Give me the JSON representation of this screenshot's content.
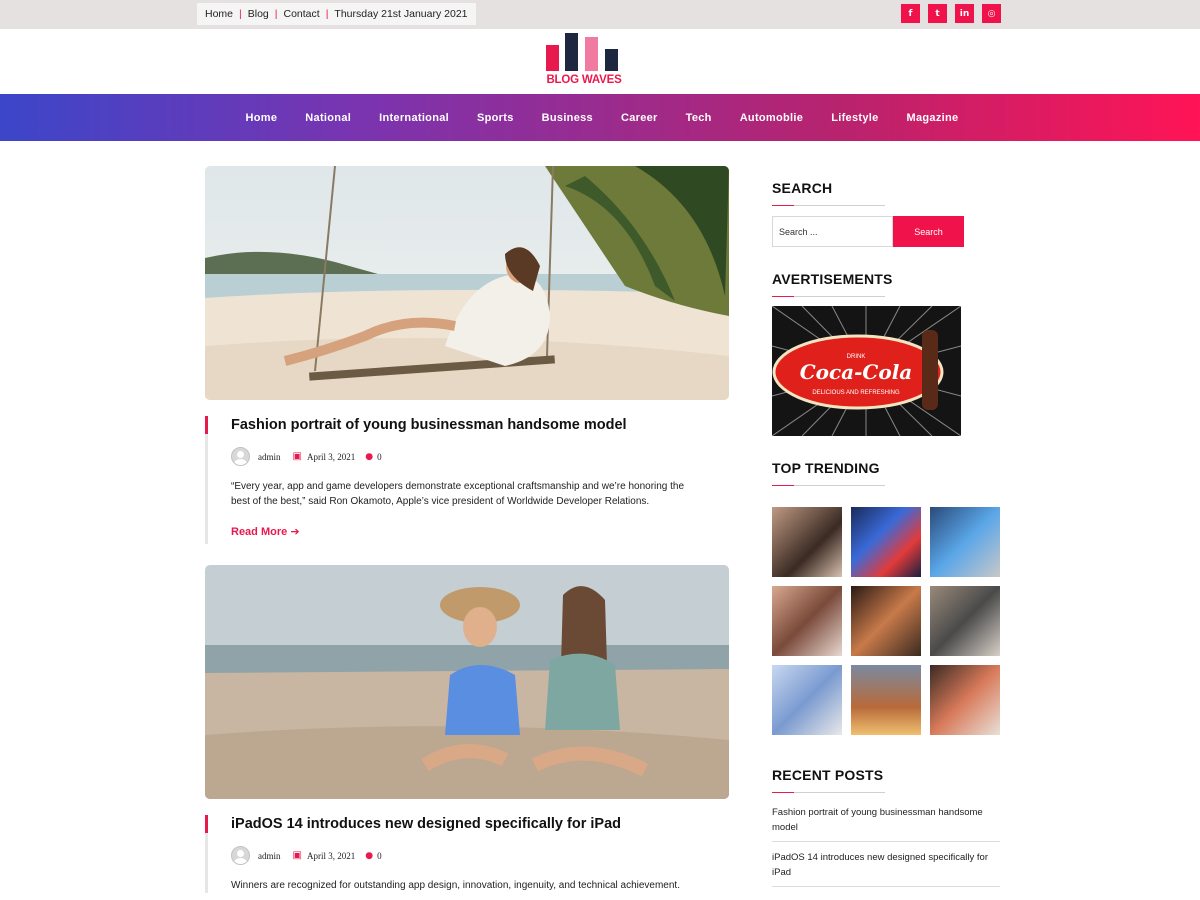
{
  "topbar": {
    "links": [
      "Home",
      "Blog",
      "Contact"
    ],
    "date": "Thursday 21st January 2021",
    "social": [
      {
        "icon": "facebook-icon",
        "glyph": "f"
      },
      {
        "icon": "twitter-icon",
        "glyph": "t"
      },
      {
        "icon": "linkedin-icon",
        "glyph": "in"
      },
      {
        "icon": "instagram-icon",
        "glyph": "◎"
      }
    ]
  },
  "logo": {
    "text": "BLOG WAVES"
  },
  "nav": {
    "items": [
      "Home",
      "National",
      "International",
      "Sports",
      "Business",
      "Career",
      "Tech",
      "Automoblie",
      "Lifestyle",
      "Magazine"
    ]
  },
  "posts": [
    {
      "title": "Fashion portrait of young businessman handsome model",
      "author": "admin",
      "date": "April 3, 2021",
      "comments": "0",
      "excerpt": "“Every year, app and game developers demonstrate exceptional craftsmanship and we’re honoring the best of the best,” said Ron Okamoto, Apple’s vice president of Worldwide Developer Relations.",
      "read_more": "Read More"
    },
    {
      "title": "iPadOS 14 introduces new designed specifically for iPad",
      "author": "admin",
      "date": "April 3, 2021",
      "comments": "0",
      "excerpt": "Winners are recognized for outstanding app design, innovation, ingenuity, and technical achievement."
    }
  ],
  "sidebar": {
    "search": {
      "title": "SEARCH",
      "placeholder": "Search ...",
      "button": "Search"
    },
    "ads": {
      "title": "AVERTISEMENTS",
      "ad_text": "Coca-Cola",
      "ad_sub": "DELICIOUS AND REFRESHING",
      "ad_drink": "DRINK"
    },
    "trending": {
      "title": "TOP TRENDING"
    },
    "recent": {
      "title": "RECENT POSTS",
      "items": [
        "Fashion portrait of young businessman handsome model",
        "iPadOS 14 introduces new designed specifically for iPad"
      ]
    }
  },
  "colors": {
    "accent": "#f0124a",
    "nav_start": "#3c46c9",
    "nav_end": "#ff1456"
  }
}
